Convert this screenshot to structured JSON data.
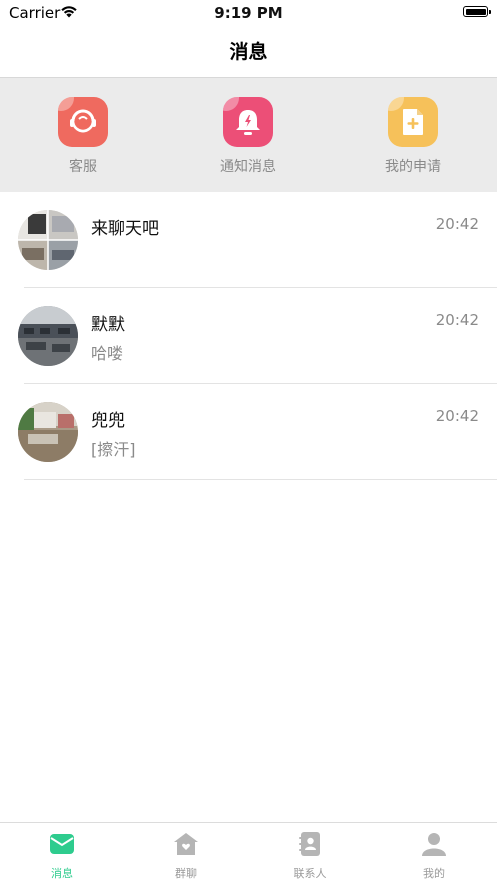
{
  "status_bar": {
    "carrier": "Carrier",
    "time": "9:19 PM"
  },
  "nav": {
    "title": "消息"
  },
  "quick_actions": [
    {
      "label": "客服",
      "icon": "headset-icon",
      "color": "#ef6a5f"
    },
    {
      "label": "通知消息",
      "icon": "bell-icon",
      "color": "#ec4f77"
    },
    {
      "label": "我的申请",
      "icon": "document-add-icon",
      "color": "#f6c15a"
    }
  ],
  "conversations": [
    {
      "name": "来聊天吧",
      "time": "20:42",
      "preview": ""
    },
    {
      "name": "默默",
      "time": "20:42",
      "preview": "哈喽"
    },
    {
      "name": "兜兜",
      "time": "20:42",
      "preview": "[擦汗]"
    }
  ],
  "tabs": [
    {
      "label": "消息",
      "icon": "envelope-icon",
      "active": true
    },
    {
      "label": "群聊",
      "icon": "home-icon",
      "active": false
    },
    {
      "label": "联系人",
      "icon": "contacts-book-icon",
      "active": false
    },
    {
      "label": "我的",
      "icon": "person-icon",
      "active": false
    }
  ],
  "colors": {
    "accent": "#2ecc8e",
    "muted": "#8a8a8a",
    "divider": "#e3e3e3"
  }
}
